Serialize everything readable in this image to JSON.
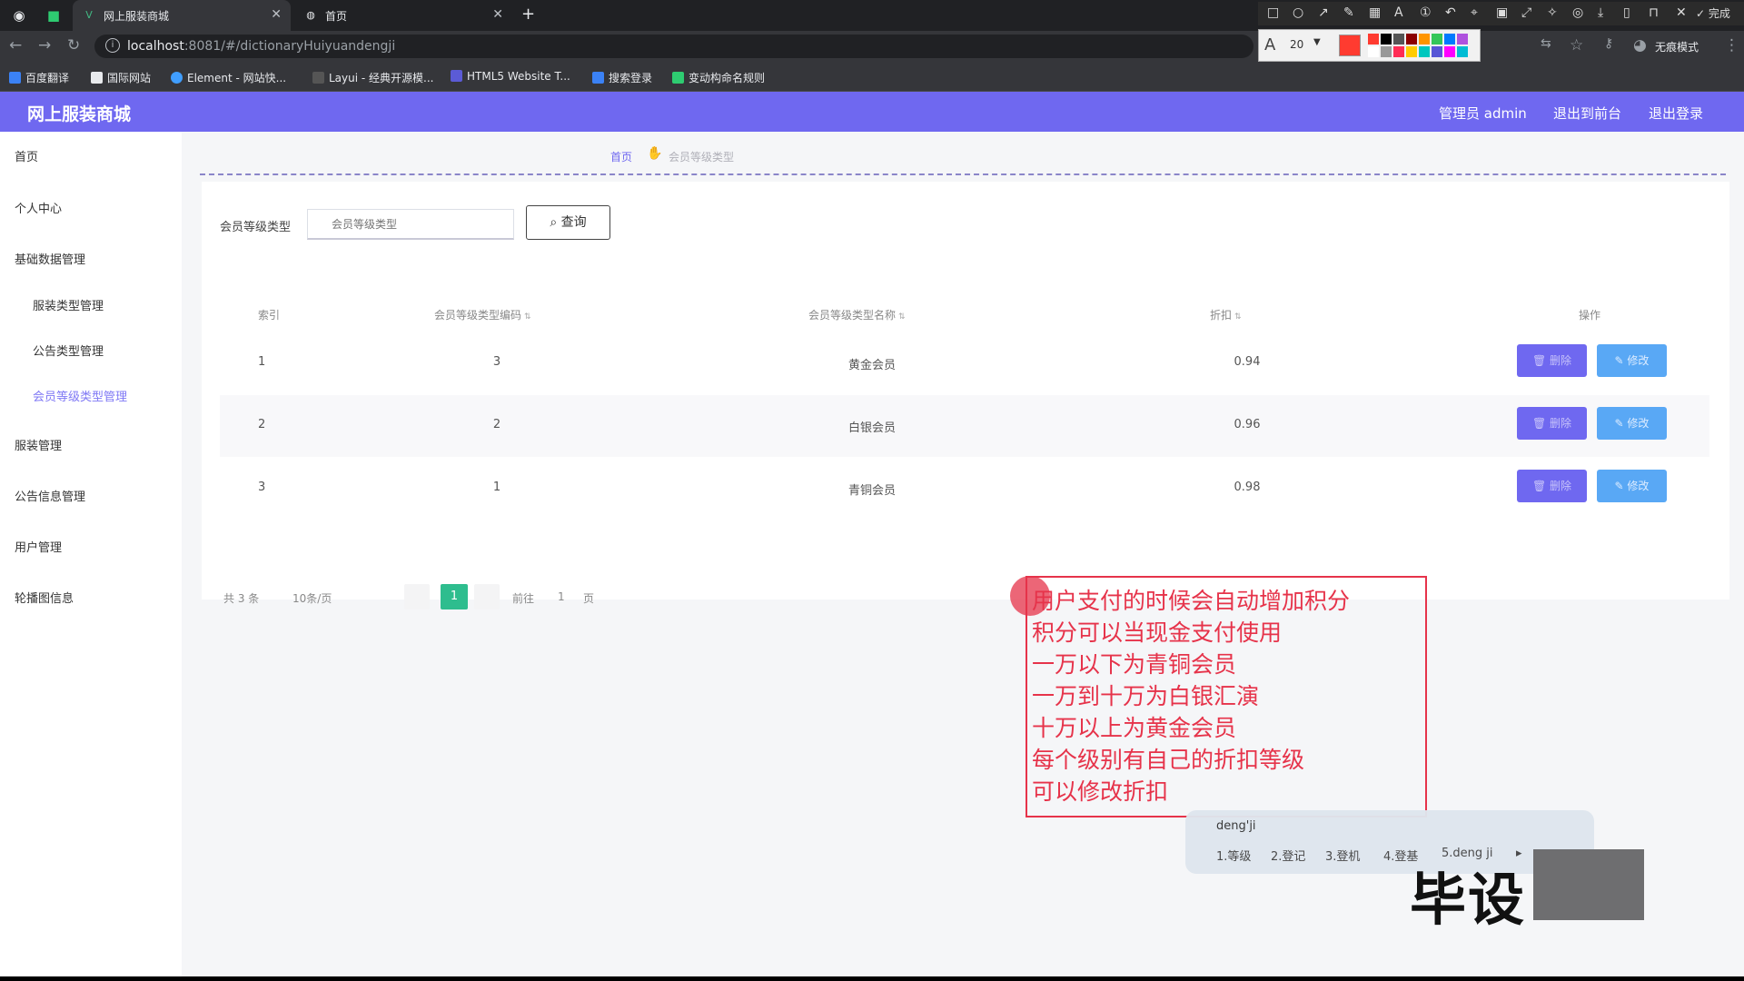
{
  "browser": {
    "tabs": [
      {
        "title": "网上服装商城",
        "active": true
      },
      {
        "title": "首页",
        "active": false
      }
    ],
    "url_host": "localhost",
    "url_path": ":8081/#/dictionaryHuiyuandengji",
    "bookmarks": [
      "百度翻译",
      "国际网站",
      "Element - 网站快...",
      "Layui - 经典开源模...",
      "HTML5 Website T...",
      "搜索登录",
      "变动构命名规则"
    ],
    "profile_label": "无痕模式"
  },
  "annotation_tool": {
    "font_size": "20",
    "done_label": "完成",
    "palette": [
      "#ff3b30",
      "#000000",
      "#555555",
      "#8b0000",
      "#ff9500",
      "#34c759",
      "#007aff",
      "#af52de",
      "#ffffff",
      "#999999",
      "#ff2d55",
      "#ffcc00",
      "#00c7be",
      "#5856d6",
      "#ff00ff",
      "#00bcd4"
    ]
  },
  "app": {
    "brand": "网上服装商城",
    "topnav": {
      "admin": "管理员 admin",
      "back_front": "退出到前台",
      "logout": "退出登录"
    },
    "sidebar": [
      {
        "label": "首页",
        "sub": false,
        "active": false
      },
      {
        "label": "个人中心",
        "sub": false,
        "active": false
      },
      {
        "label": "基础数据管理",
        "sub": false,
        "active": false
      },
      {
        "label": "服装类型管理",
        "sub": true,
        "active": false
      },
      {
        "label": "公告类型管理",
        "sub": true,
        "active": false
      },
      {
        "label": "会员等级类型管理",
        "sub": true,
        "active": true
      },
      {
        "label": "服装管理",
        "sub": false,
        "active": false
      },
      {
        "label": "公告信息管理",
        "sub": false,
        "active": false
      },
      {
        "label": "用户管理",
        "sub": false,
        "active": false
      },
      {
        "label": "轮播图信息",
        "sub": false,
        "active": false
      }
    ],
    "breadcrumb": {
      "home": "首页",
      "current": "会员等级类型"
    },
    "search": {
      "label": "会员等级类型",
      "placeholder": "会员等级类型",
      "button": "查询"
    },
    "table": {
      "headers": [
        "索引",
        "会员等级类型编码",
        "会员等级类型名称",
        "折扣",
        "操作"
      ],
      "rows": [
        {
          "index": "1",
          "code": "3",
          "name": "黄金会员",
          "discount": "0.94"
        },
        {
          "index": "2",
          "code": "2",
          "name": "白银会员",
          "discount": "0.96"
        },
        {
          "index": "3",
          "code": "1",
          "name": "青铜会员",
          "discount": "0.98"
        }
      ],
      "delete_label": "删除",
      "edit_label": "修改"
    },
    "pagination": {
      "total": "共 3 条",
      "page_size": "10条/页",
      "current": "1",
      "goto": "前往",
      "goto_value": "1",
      "page_unit": "页"
    }
  },
  "note": {
    "lines": [
      "用户支付的时候会自动增加积分",
      "积分可以当现金支付使用",
      "一万以下为青铜会员",
      "一万到十万为白银汇演",
      "十万以上为黄金会员",
      "每个级别有自己的折扣等级",
      "可以修改折扣"
    ]
  },
  "ime": {
    "input": "deng'ji",
    "candidates": [
      "1.等级",
      "2.登记",
      "3.登机",
      "4.登基",
      "5.deng ji"
    ]
  },
  "watermark": "毕设"
}
